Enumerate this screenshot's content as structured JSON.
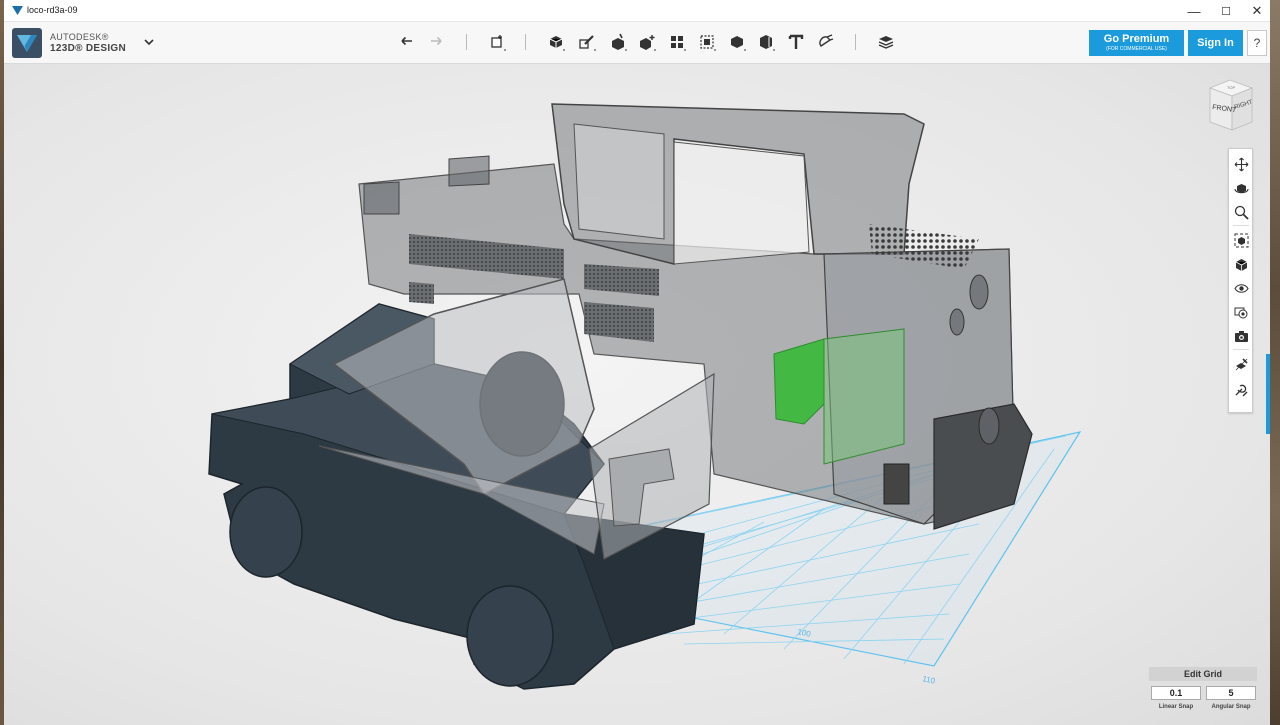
{
  "window": {
    "title": "loco-rd3a-09"
  },
  "window_controls": {
    "minimize": "—",
    "maximize": "☐",
    "close": "✕"
  },
  "brand": {
    "line1": "AUTODESK®",
    "line2": "123D® DESIGN"
  },
  "toolbar": {
    "undo": "undo-icon",
    "redo": "redo-icon",
    "tools": [
      "transform-icon",
      "primitives-icon",
      "sketch-icon",
      "construct-icon",
      "modify-icon",
      "pattern-icon",
      "group-icon",
      "combine-icon",
      "measure-icon",
      "text-icon",
      "snap-icon",
      "material-icon"
    ]
  },
  "account": {
    "premium_label": "Go Premium",
    "premium_sub": "(FOR COMMERCIAL USE)",
    "signin_label": "Sign In",
    "help_label": "?"
  },
  "viewcube": {
    "front": "FRONT",
    "right": "RIGHT",
    "top": "TOP"
  },
  "navbar": [
    "pan-icon",
    "orbit-icon",
    "zoom-icon",
    "fit-icon",
    "views-icon",
    "visibility-icon",
    "materials-icon",
    "screenshot-icon",
    "snap-grid-icon",
    "settings-icon"
  ],
  "grid": {
    "label_100": "100",
    "label_110": "110"
  },
  "edit_grid": {
    "label": "Edit Grid",
    "linear_snap_value": "0.1",
    "linear_snap_label": "Linear Snap",
    "angular_snap_value": "5",
    "angular_snap_label": "Angular Snap"
  },
  "colors": {
    "accent": "#1b9bdb",
    "chassis": "#34404a",
    "shell": "#8a8d90",
    "highlight": "#4fc14f",
    "grid": "#7fd0f0"
  }
}
